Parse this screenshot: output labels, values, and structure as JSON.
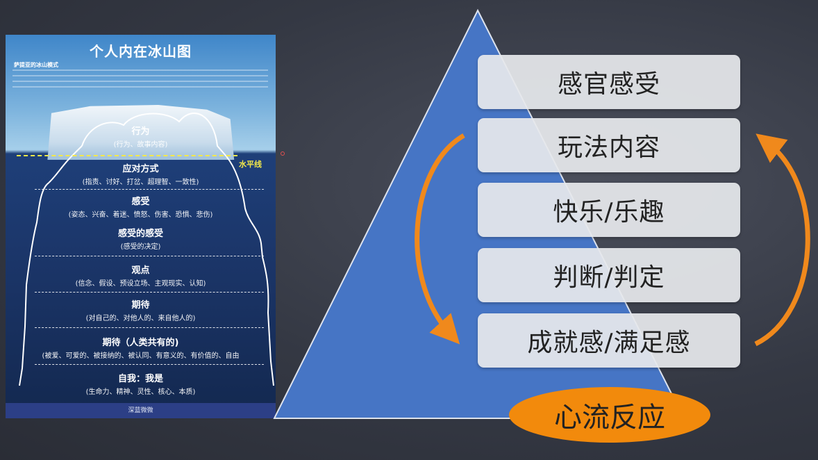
{
  "poster": {
    "title": "个人内在冰山图",
    "subtitle": "萨提亚的冰山模式",
    "water_line_label": "水平线",
    "layers": [
      {
        "title": "行为",
        "sub": "(行为、故事内容)"
      },
      {
        "title": "应对方式",
        "sub": "(指责、讨好、打岔、超理智、一致性)"
      },
      {
        "title": "感受",
        "sub": "(姿态、兴奋、着迷、愤怒、伤害、恐惧、悲伤)"
      },
      {
        "title": "感受的感受",
        "sub": "(感受的决定)"
      },
      {
        "title": "观点",
        "sub": "(信念、假设、预设立场、主观现实、认知)"
      },
      {
        "title": "期待",
        "sub": "(对自己的、对他人的、来自他人的)"
      },
      {
        "title": "期待（人类共有的)",
        "sub": "(被爱、可爱的、被接纳的、被认同、有意义的、有价值的、自由"
      },
      {
        "title": "自我：我是",
        "sub": "(生命力、精神、灵性、核心、本质)"
      }
    ],
    "footer": "深蓝微微"
  },
  "pyramid": {
    "levels": [
      "感官感受",
      "玩法内容",
      "快乐/乐趣",
      "判断/判定",
      "成就感/满足感"
    ],
    "base_label": "心流反应"
  },
  "colors": {
    "pyramid_blue": "#4675c5",
    "arrow_orange": "#f0891c",
    "ellipse_orange": "#f28a0c",
    "box_fill": "#e6e8ec"
  }
}
